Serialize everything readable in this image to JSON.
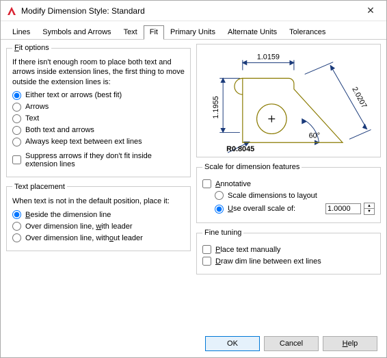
{
  "window": {
    "title": "Modify Dimension Style: Standard"
  },
  "tabs": {
    "lines": "Lines",
    "symbols": "Symbols and Arrows",
    "text": "Text",
    "fit": "Fit",
    "primary": "Primary Units",
    "alt": "Alternate Units",
    "tol": "Tolerances",
    "active": "fit"
  },
  "fit": {
    "legend": "Fit options",
    "desc": "If there isn't enough room to place both text and arrows inside extension lines, the first thing to move outside the extension lines is:",
    "opt_either": "Either text or arrows (best fit)",
    "opt_arrows": "Arrows",
    "opt_text": "Text",
    "opt_both": "Both text and arrows",
    "opt_always": "Always keep text between ext lines",
    "suppress": "Suppress arrows if they don't fit inside extension lines"
  },
  "placement": {
    "legend": "Text placement",
    "desc": "When text is not in the default position, place it:",
    "beside": "Beside the dimension line",
    "over_leader": "Over dimension line, with leader",
    "over_noleader": "Over dimension line, without leader"
  },
  "scale": {
    "legend": "Scale for dimension features",
    "annotative": "Annotative",
    "toLayout": "Scale dimensions to layout",
    "overall": "Use overall scale of:",
    "value": "1.0000"
  },
  "fine": {
    "legend": "Fine tuning",
    "manual": "Place text manually",
    "drawdim": "Draw dim line between ext lines"
  },
  "preview": {
    "d1": "1.0159",
    "d2": "1.1955",
    "d3": "2.0207",
    "r": "R0.8045",
    "ang": "60°"
  },
  "buttons": {
    "ok": "OK",
    "cancel": "Cancel",
    "help": "Help"
  }
}
